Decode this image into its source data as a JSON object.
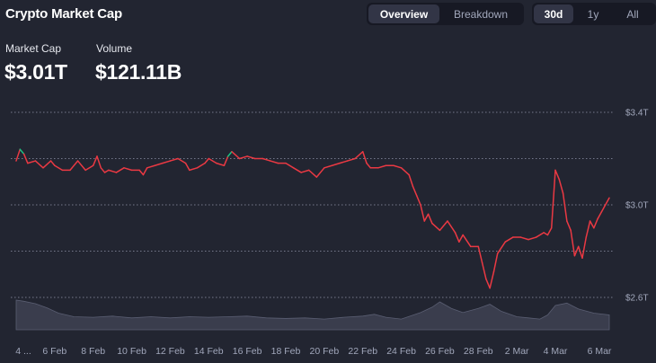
{
  "header": {
    "title": "Crypto Market Cap",
    "view_tabs": [
      {
        "label": "Overview",
        "active": true
      },
      {
        "label": "Breakdown",
        "active": false
      }
    ],
    "range_tabs": [
      {
        "label": "30d",
        "active": true
      },
      {
        "label": "1y",
        "active": false
      },
      {
        "label": "All",
        "active": false
      }
    ]
  },
  "stats": {
    "market_cap_label": "Market Cap",
    "market_cap_value": "$3.01T",
    "volume_label": "Volume",
    "volume_value": "$121.11B"
  },
  "colors": {
    "background": "#222531",
    "down_line": "#ea3943",
    "up_line": "#16c784",
    "volume_fill": "#3a3d4d",
    "grid": "#8a8fa3"
  },
  "chart_data": {
    "type": "line",
    "y_ticks": [
      "$3.4T",
      "$3.0T",
      "$2.6T"
    ],
    "y_tick_values": [
      3.4,
      3.0,
      2.6
    ],
    "ylim": [
      2.6,
      3.4
    ],
    "grid": "horizontal-dotted",
    "x_tick_labels": [
      "4 ...",
      "6 Feb",
      "8 Feb",
      "10 Feb",
      "12 Feb",
      "14 Feb",
      "16 Feb",
      "18 Feb",
      "20 Feb",
      "22 Feb",
      "24 Feb",
      "26 Feb",
      "28 Feb",
      "2 Mar",
      "4 Mar",
      "6 Mar"
    ],
    "xlim": [
      4.0,
      34.8
    ],
    "reference_value": 3.18,
    "market_cap": {
      "x": [
        4.0,
        4.2,
        4.4,
        4.6,
        5.0,
        5.4,
        5.8,
        6.0,
        6.4,
        6.8,
        7.2,
        7.6,
        8.0,
        8.2,
        8.4,
        8.6,
        8.8,
        9.2,
        9.6,
        10.0,
        10.4,
        10.6,
        10.8,
        11.2,
        11.6,
        12.0,
        12.4,
        12.8,
        13.0,
        13.4,
        13.8,
        14.0,
        14.4,
        14.8,
        15.0,
        15.2,
        15.6,
        16.0,
        16.4,
        16.8,
        17.2,
        17.6,
        18.0,
        18.4,
        18.8,
        19.2,
        19.6,
        20.0,
        20.4,
        20.8,
        21.2,
        21.6,
        22.0,
        22.2,
        22.4,
        22.8,
        23.2,
        23.6,
        24.0,
        24.4,
        24.6,
        24.8,
        25.0,
        25.2,
        25.4,
        25.6,
        26.0,
        26.4,
        26.8,
        27.0,
        27.2,
        27.6,
        28.0,
        28.2,
        28.4,
        28.6,
        28.8,
        29.0,
        29.4,
        29.8,
        30.2,
        30.6,
        31.0,
        31.4,
        31.6,
        31.8,
        32.0,
        32.2,
        32.4,
        32.6,
        32.8,
        33.0,
        33.2,
        33.4,
        33.6,
        33.8,
        34.0,
        34.2,
        34.4,
        34.6,
        34.8
      ],
      "y": [
        3.19,
        3.24,
        3.22,
        3.18,
        3.19,
        3.16,
        3.19,
        3.17,
        3.15,
        3.15,
        3.19,
        3.15,
        3.17,
        3.21,
        3.16,
        3.14,
        3.15,
        3.14,
        3.16,
        3.15,
        3.15,
        3.13,
        3.16,
        3.17,
        3.18,
        3.19,
        3.2,
        3.18,
        3.15,
        3.16,
        3.18,
        3.2,
        3.18,
        3.17,
        3.21,
        3.23,
        3.2,
        3.21,
        3.2,
        3.2,
        3.19,
        3.18,
        3.18,
        3.16,
        3.14,
        3.15,
        3.12,
        3.16,
        3.17,
        3.18,
        3.19,
        3.2,
        3.23,
        3.18,
        3.16,
        3.16,
        3.17,
        3.17,
        3.16,
        3.13,
        3.08,
        3.04,
        3.0,
        2.93,
        2.96,
        2.92,
        2.89,
        2.93,
        2.88,
        2.84,
        2.87,
        2.82,
        2.82,
        2.75,
        2.68,
        2.64,
        2.71,
        2.79,
        2.84,
        2.86,
        2.86,
        2.85,
        2.86,
        2.88,
        2.87,
        2.9,
        3.15,
        3.11,
        3.05,
        2.93,
        2.89,
        2.78,
        2.82,
        2.77,
        2.86,
        2.93,
        2.9,
        2.94,
        2.97,
        3.0,
        3.03
      ]
    },
    "volume": {
      "x": [
        4.0,
        4.4,
        5.0,
        5.6,
        6.2,
        7.0,
        8.0,
        9.0,
        10.0,
        11.0,
        12.0,
        13.0,
        14.0,
        15.0,
        16.0,
        17.0,
        18.0,
        19.0,
        20.0,
        21.0,
        22.0,
        22.6,
        23.2,
        24.0,
        25.0,
        25.6,
        26.0,
        26.6,
        27.2,
        28.0,
        28.6,
        29.2,
        30.0,
        30.6,
        31.2,
        31.6,
        32.0,
        32.6,
        33.2,
        34.0,
        34.8
      ],
      "y": [
        100,
        96,
        88,
        74,
        56,
        44,
        42,
        46,
        40,
        44,
        40,
        44,
        42,
        44,
        46,
        40,
        38,
        40,
        36,
        42,
        46,
        52,
        42,
        36,
        58,
        76,
        94,
        72,
        58,
        72,
        86,
        62,
        44,
        40,
        36,
        50,
        82,
        90,
        70,
        56,
        50
      ]
    }
  }
}
